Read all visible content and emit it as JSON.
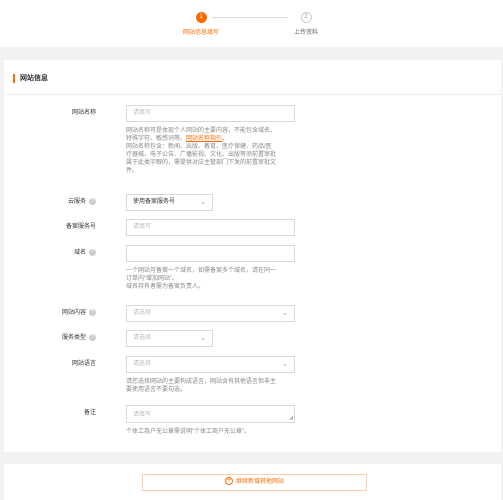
{
  "steps": [
    {
      "num": "1",
      "label": "网站信息填写"
    },
    {
      "num": "2",
      "label": "上传资料"
    }
  ],
  "section_title": "网站信息",
  "fields": {
    "site_name": {
      "label": "网站名称",
      "placeholder": "请填写"
    },
    "site_name_help": {
      "line1": "网站名称可是体现个人网站的主要内容，不能包含域名、",
      "line2a": "特殊字符、敏感词等。",
      "line2_link": "网站名称指引",
      "line2b": "。",
      "line3": "网站名称包含：新闻、出版、教育、医疗保健、药品/医",
      "line4": "疗器械、电子公告、广播影视、文化、出版等须前置审批",
      "line5": "属于此类字眼的，需提供对应主管部门下发的前置审批文",
      "line6": "件。"
    },
    "cloud_service": {
      "label": "云服务",
      "value": "使用备案服务号"
    },
    "filing_service_no": {
      "label": "备案服务号",
      "placeholder": "请填写"
    },
    "domain": {
      "label": "域名",
      "placeholder": ""
    },
    "domain_help": {
      "line1": "一个网站可备案一个域名，如需备案多个域名，请在同一",
      "line2": "订单内“增加网站”。",
      "line3": "域名持有者需为备案负责人。"
    },
    "site_content": {
      "label": "网站内容",
      "placeholder": "请选择"
    },
    "service_type": {
      "label": "服务类型",
      "placeholder": "请选择"
    },
    "site_language": {
      "label": "网站语言",
      "placeholder": "请选择"
    },
    "language_help": {
      "line1": "请您选择网站的主要构成语言，网站含有其他语言但非主",
      "line2": "要使用语言不要勾选。"
    },
    "remarks": {
      "label": "备注",
      "placeholder": "请填写"
    },
    "remarks_help": "个体工商户无公章需说明“个体工商户无公章”。"
  },
  "add_button_label": "继续新增其他网站",
  "colors": {
    "accent": "#ff6a00"
  }
}
